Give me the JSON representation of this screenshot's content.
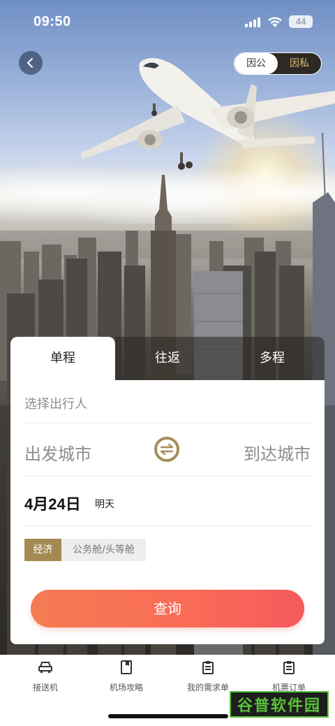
{
  "status_bar": {
    "time": "09:50",
    "battery": "44"
  },
  "header": {
    "toggle": {
      "business_label": "因公",
      "personal_label": "因私",
      "selected": "因公"
    }
  },
  "trip_tabs": [
    {
      "label": "单程",
      "active": true
    },
    {
      "label": "往返",
      "active": false
    },
    {
      "label": "多程",
      "active": false
    }
  ],
  "form": {
    "traveler_placeholder": "选择出行人",
    "departure_city_placeholder": "出发城市",
    "arrival_city_placeholder": "到达城市",
    "date": "4月24日",
    "date_suffix": "明天",
    "cabin_options": [
      {
        "label": "经济",
        "selected": true
      },
      {
        "label": "公务舱/头等舱",
        "selected": false
      }
    ],
    "search_label": "查询"
  },
  "bottom_nav": [
    {
      "label": "接送机",
      "icon": "car-icon"
    },
    {
      "label": "机场攻略",
      "icon": "book-icon"
    },
    {
      "label": "我的需求单",
      "icon": "clipboard-icon"
    },
    {
      "label": "机票订单",
      "icon": "order-icon"
    }
  ],
  "watermark": {
    "text": "谷普软件园"
  },
  "colors": {
    "accent_gold": "#a48a52",
    "search_gradient_start": "#f47c52",
    "search_gradient_end": "#f55a5d"
  }
}
